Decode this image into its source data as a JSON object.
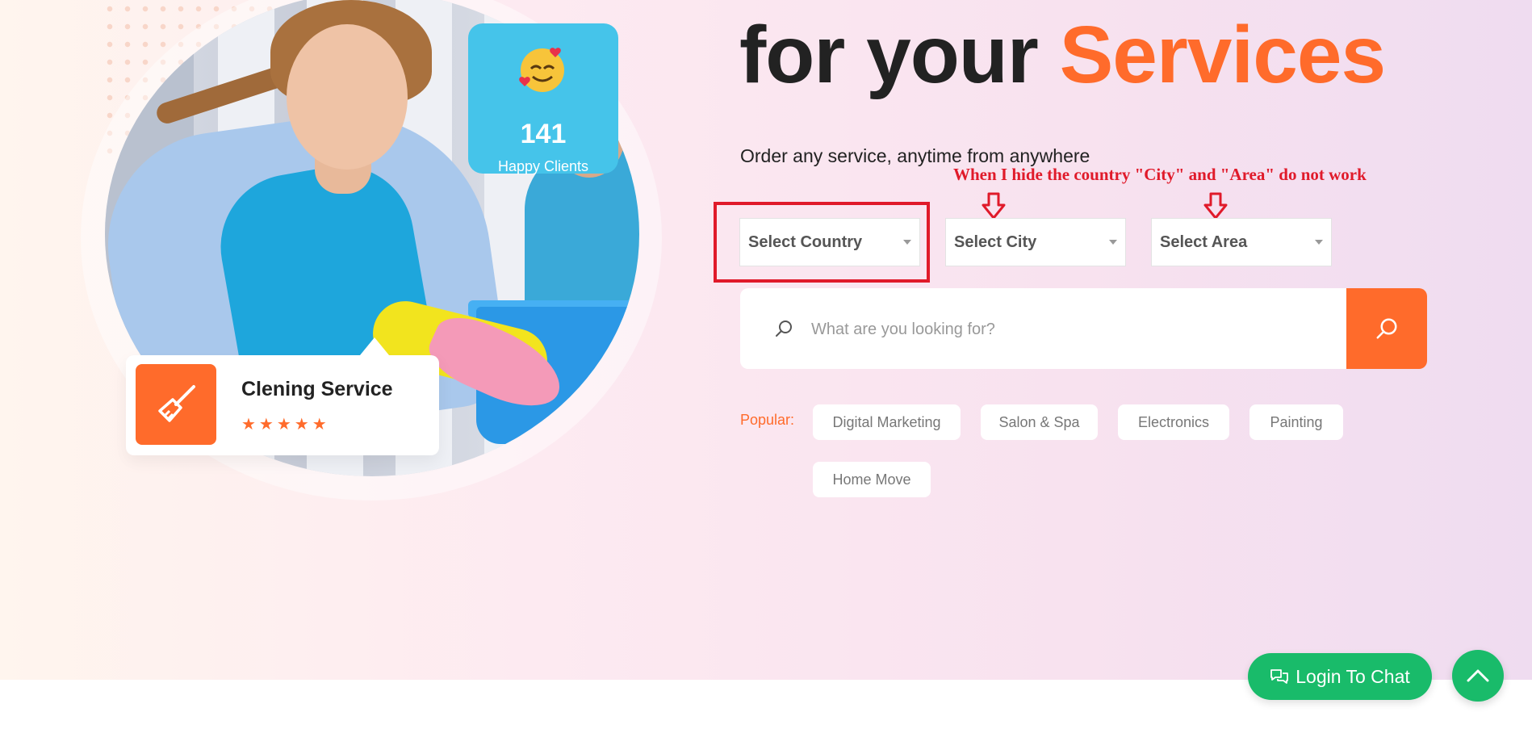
{
  "hero": {
    "heading_prefix": "for your ",
    "heading_accent": "Services",
    "subtitle": "Order any service, anytime from anywhere"
  },
  "clients_card": {
    "count": "141",
    "label": "Happy Clients"
  },
  "service_card": {
    "title": "Clening Service",
    "rating_stars": 5,
    "stars_text": "★★★★★"
  },
  "annotation": {
    "note": "When I hide the country \"City\" and \"Area\" do not work"
  },
  "selects": {
    "country": "Select Country",
    "city": "Select City",
    "area": "Select Area"
  },
  "search": {
    "placeholder": "What are you looking for?"
  },
  "popular": {
    "label": "Popular:",
    "tags": [
      "Digital Marketing",
      "Salon & Spa",
      "Electronics",
      "Painting",
      "Home Move"
    ]
  },
  "chat": {
    "label": "Login To Chat"
  },
  "colors": {
    "accent": "#ff6b2b",
    "clients_card": "#45c4ea",
    "chat_green": "#19bb6a",
    "annotation_red": "#e01a2a"
  }
}
